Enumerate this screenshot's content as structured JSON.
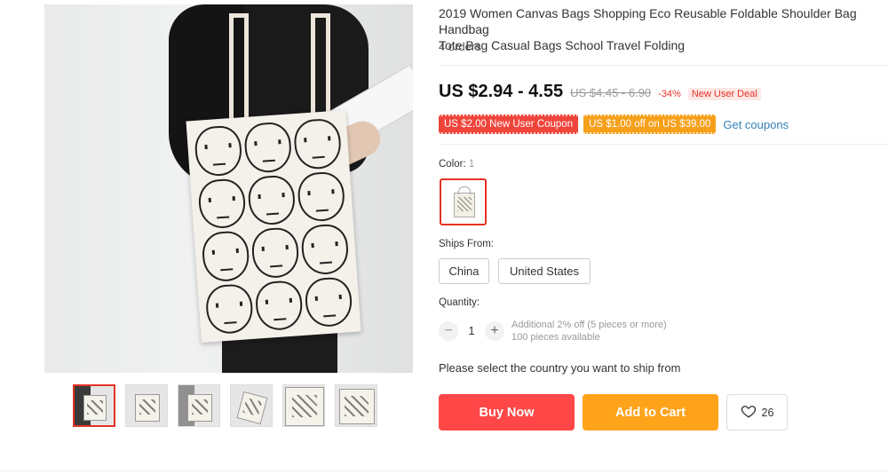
{
  "product": {
    "title_line1": "2019 Women Canvas Bags Shopping Eco Reusable Foldable Shoulder Bag Handbag",
    "title_line2": "Tote Bag Casual Bags School Travel Folding",
    "orders": "4 orders"
  },
  "price": {
    "current": "US $2.94 - 4.55",
    "original": "US $4.45 - 6.90",
    "discount": "-34%",
    "badge": "New User Deal"
  },
  "coupons": {
    "items": [
      "US $2.00 New User Coupon",
      "US $1.00 off on US $39.00"
    ],
    "get_label": "Get coupons"
  },
  "color": {
    "label": "Color:",
    "value": "1"
  },
  "ships_from": {
    "label": "Ships From:",
    "options": [
      "China",
      "United States"
    ]
  },
  "quantity": {
    "label": "Quantity:",
    "minus": "−",
    "plus": "+",
    "value": "1",
    "note1": "Additional 2% off (5 pieces or more)",
    "note2": "100 pieces available"
  },
  "ship_message": "Please select the country you want to ship from",
  "actions": {
    "buy": "Buy Now",
    "cart": "Add to Cart",
    "wishlist_count": "26"
  },
  "colors": {
    "buy": "#ff4747",
    "cart": "#ffa31a",
    "accent": "#e43225",
    "link": "#3381b8"
  },
  "gallery": {
    "thumbnail_count": 6,
    "selected_thumbnail": 1
  }
}
